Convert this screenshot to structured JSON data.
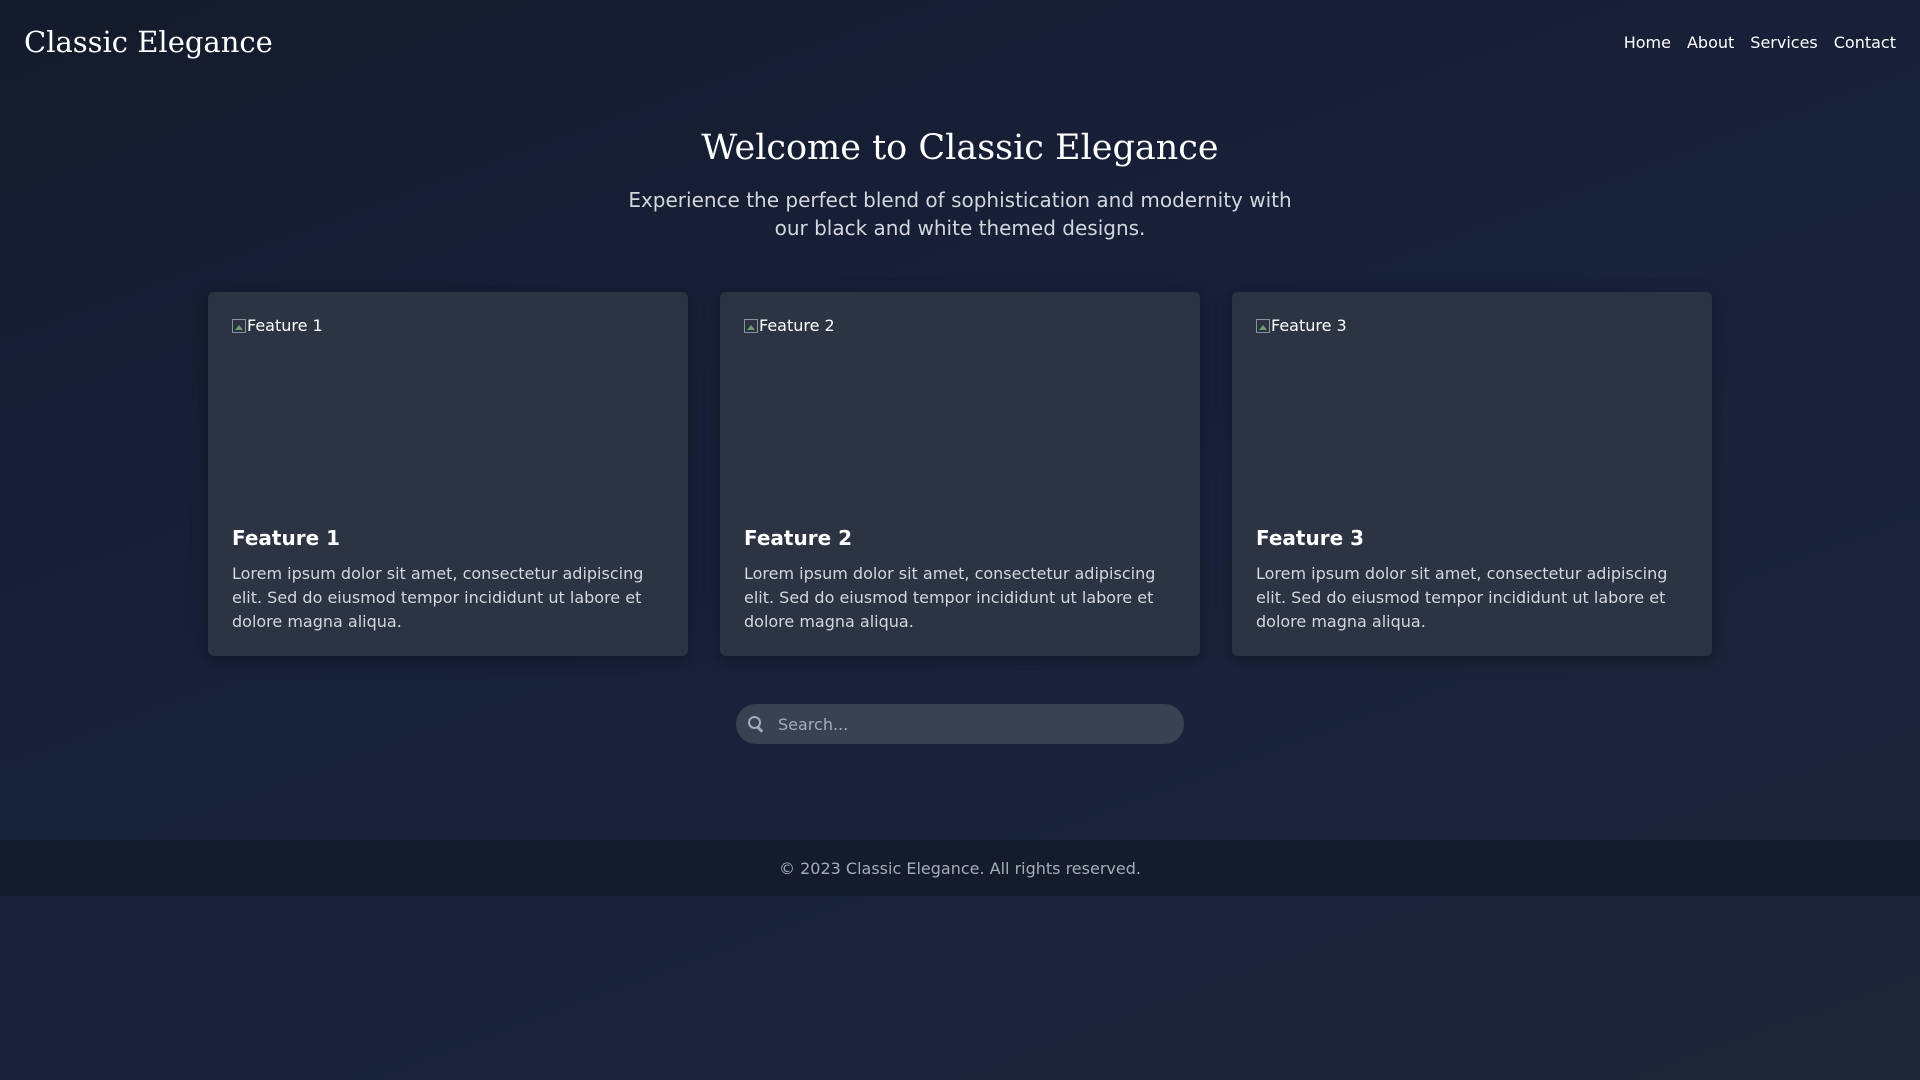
{
  "header": {
    "logo": "Classic Elegance",
    "nav": [
      "Home",
      "About",
      "Services",
      "Contact"
    ]
  },
  "hero": {
    "title": "Welcome to Classic Elegance",
    "subtitle": "Experience the perfect blend of sophistication and modernity with our black and white themed designs."
  },
  "features": [
    {
      "image_alt": "Feature 1",
      "title": "Feature 1",
      "description": "Lorem ipsum dolor sit amet, consectetur adipiscing elit. Sed do eiusmod tempor incididunt ut labore et dolore magna aliqua."
    },
    {
      "image_alt": "Feature 2",
      "title": "Feature 2",
      "description": "Lorem ipsum dolor sit amet, consectetur adipiscing elit. Sed do eiusmod tempor incididunt ut labore et dolore magna aliqua."
    },
    {
      "image_alt": "Feature 3",
      "title": "Feature 3",
      "description": "Lorem ipsum dolor sit amet, consectetur adipiscing elit. Sed do eiusmod tempor incididunt ut labore et dolore magna aliqua."
    }
  ],
  "search": {
    "placeholder": "Search...",
    "icon": "search-icon"
  },
  "footer": {
    "text": "© 2023 Classic Elegance. All rights reserved."
  },
  "colors": {
    "background": "#18213a",
    "card": "#2c3342",
    "footer": "#141b2a",
    "text": "#ffffff",
    "muted_text": "#d3d6dd"
  }
}
